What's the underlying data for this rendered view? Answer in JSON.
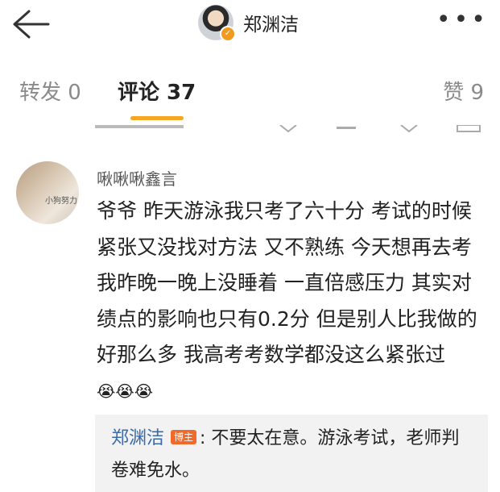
{
  "header": {
    "title": "郑渊洁",
    "back_icon": "arrow-left-icon",
    "more_icon": "more-horizontal-icon",
    "more_label": "•••",
    "verified_icon": "verified-icon"
  },
  "tabs": [
    {
      "label": "转发 0"
    },
    {
      "label": "评论 37"
    },
    {
      "label": "赞 9"
    }
  ],
  "comment": {
    "username": "啾啾啾鑫言",
    "avatar_caption": "小狗努力",
    "text": "爷爷 昨天游泳我只考了六十分 考试的时候紧张又没找对方法 又不熟练 今天想再去考 我昨晚一晚上没睡着 一直倍感压力 其实对绩点的影响也只有0.2分 但是别人比我做的好那么多 我高考考数学都没这么紧张过",
    "emojis": "😭😭😭"
  },
  "reply": {
    "author": "郑渊洁",
    "badge": "博主",
    "text": ": 不要太在意。游泳考试，老师判卷难免水。"
  },
  "colors": {
    "accent_underline": "#f6a623",
    "link": "#3b6aa8",
    "badge": "#f26a2a"
  }
}
